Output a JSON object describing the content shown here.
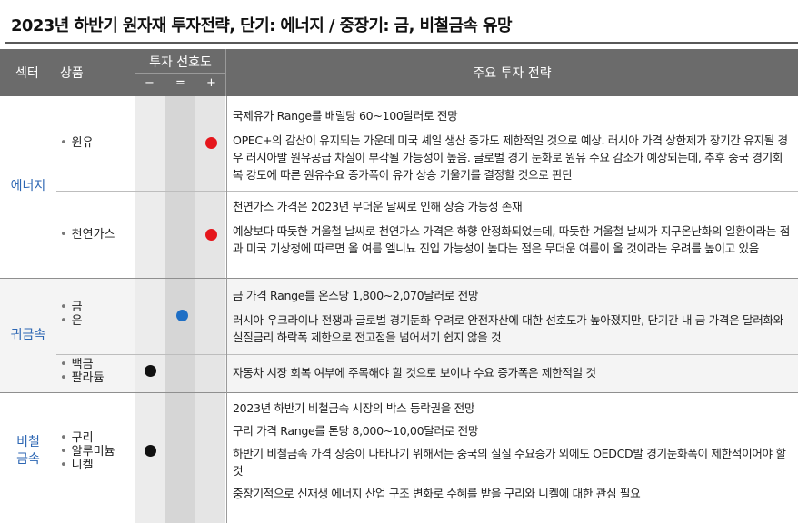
{
  "title": "2023년 하반기 원자재 투자전략, 단기: 에너지 / 중장기: 금, 비철금속 유망",
  "header": {
    "sector": "섹터",
    "product": "상품",
    "preference": "투자 선호도",
    "minus": "−",
    "equal": "=",
    "plus": "+",
    "strategy": "주요 투자 전략"
  },
  "colors": {
    "header_bg": "#6b6b6b",
    "sector_text": "#2c66b3",
    "dot_red": "#e5161c",
    "dot_blue": "#1f6fc5",
    "dot_black": "#111111"
  },
  "groups": {
    "energy": {
      "sector": "에너지",
      "crude": {
        "product": "원유",
        "preference": "+",
        "headline": "국제유가 Range를 배럴당 60~100달러로 전망",
        "detail": "OPEC+의 감산이 유지되는 가운데 미국 셰일 생산 증가도 제한적일 것으로 예상. 러시아 가격 상한제가 장기간 유지될 경우 러시아발 원유공급 차질이 부각될 가능성이 높음. 글로벌 경기 둔화로 원유 수요 감소가 예상되는데, 추후 중국 경기회복 강도에 따른 원유수요 증가폭이 유가 상승 기울기를 결정할 것으로 판단"
      },
      "natgas": {
        "product": "천연가스",
        "preference": "+",
        "headline": "천연가스 가격은 2023년 무더운 날씨로 인해 상승 가능성 존재",
        "detail": "예상보다 따듯한 겨울철 날씨로 천연가스 가격은 하향 안정화되었는데, 따듯한 겨울철 날씨가 지구온난화의 일환이라는 점과 미국 기상청에 따르면 올 여름 엘니뇨 진입 가능성이 높다는 점은 무더운 여름이 올 것이라는 우려를 높이고 있음"
      }
    },
    "precious": {
      "sector": "귀금속",
      "gold_silver": {
        "products": [
          "금",
          "은"
        ],
        "preference": "=",
        "headline": "금 가격 Range를 온스당 1,800~2,070달러로 전망",
        "detail": "러시아-우크라이나 전쟁과 글로벌 경기둔화 우려로 안전자산에 대한 선호도가 높아졌지만, 단기간 내 금 가격은 달러화와 실질금리 하락폭 제한으로 전고점을 넘어서기 쉽지 않을 것"
      },
      "pgm": {
        "products": [
          "백금",
          "팔라듐"
        ],
        "preference": "−",
        "headline": "자동차 시장 회복 여부에 주목해야 할 것으로 보이나 수요 증가폭은 제한적일 것"
      }
    },
    "base": {
      "sector_line1": "비철",
      "sector_line2": "금속",
      "products": [
        "구리",
        "알루미늄",
        "니켈"
      ],
      "preference": "−",
      "lines": [
        "2023년 하반기 비철금속 시장의 박스 등락권을 전망",
        "구리 가격 Range를 톤당 8,000~10,00달러로 전망",
        "하반기 비철금속 가격 상승이 나타나기 위해서는 중국의 실질 수요증가 외에도 OEDCD발 경기둔화폭이 제한적이어야 할 것",
        "중장기적으로 신재생 에너지 산업 구조 변화로 수혜를 받을 구리와 니켈에 대한 관심 필요"
      ]
    }
  }
}
